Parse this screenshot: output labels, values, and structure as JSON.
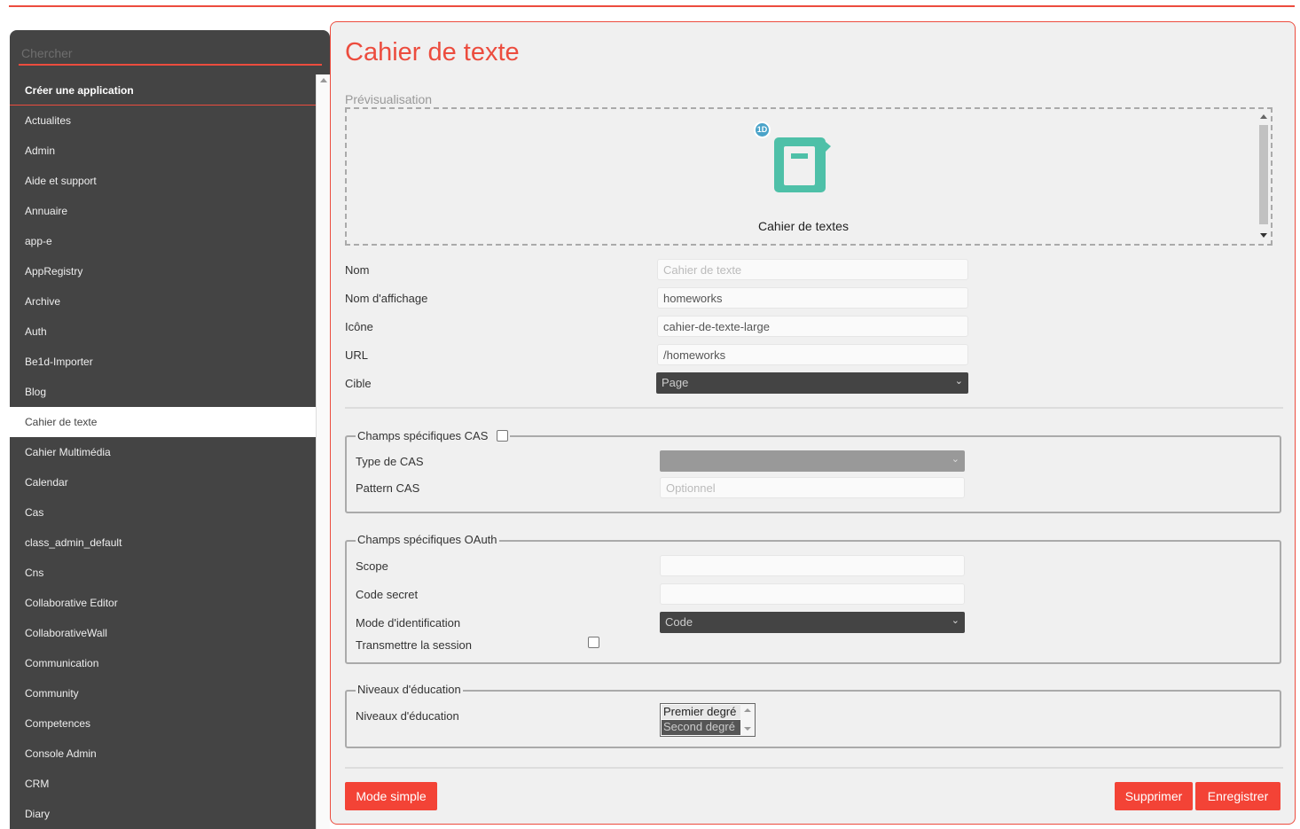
{
  "sidebar": {
    "search_placeholder": "Chercher",
    "create_label": "Créer une application",
    "items": [
      "Actualites",
      "Admin",
      "Aide et support",
      "Annuaire",
      "app-e",
      "AppRegistry",
      "Archive",
      "Auth",
      "Be1d-Importer",
      "Blog",
      "Cahier de texte",
      "Cahier Multimédia",
      "Calendar",
      "Cas",
      "class_admin_default",
      "Cns",
      "Collaborative Editor",
      "CollaborativeWall",
      "Communication",
      "Community",
      "Competences",
      "Console Admin",
      "CRM",
      "Diary"
    ],
    "active_item": "Cahier de texte"
  },
  "main": {
    "title": "Cahier de texte",
    "preview_label": "Prévisualisation",
    "preview": {
      "badge": "1D",
      "app_name": "Cahier de textes",
      "icon": "notebook-icon",
      "icon_color": "#4ec0a8"
    },
    "fields": {
      "nom_label": "Nom",
      "nom_placeholder": "Cahier de texte",
      "display_label": "Nom d'affichage",
      "display_value": "homeworks",
      "icon_label": "Icône",
      "icon_value": "cahier-de-texte-large",
      "url_label": "URL",
      "url_value": "/homeworks",
      "target_label": "Cible",
      "target_value": "Page"
    },
    "cas": {
      "legend": "Champs spécifiques CAS",
      "type_label": "Type de CAS",
      "pattern_label": "Pattern CAS",
      "pattern_placeholder": "Optionnel"
    },
    "oauth": {
      "legend": "Champs spécifiques OAuth",
      "scope_label": "Scope",
      "secret_label": "Code secret",
      "mode_label": "Mode d'identification",
      "mode_value": "Code",
      "session_label": "Transmettre la session"
    },
    "education": {
      "legend": "Niveaux d'éducation",
      "label": "Niveaux d'éducation",
      "options": [
        "Premier degré",
        "Second degré"
      ]
    },
    "buttons": {
      "simple": "Mode simple",
      "delete": "Supprimer",
      "save": "Enregistrer"
    },
    "accent_color": "#ec4c3e"
  }
}
